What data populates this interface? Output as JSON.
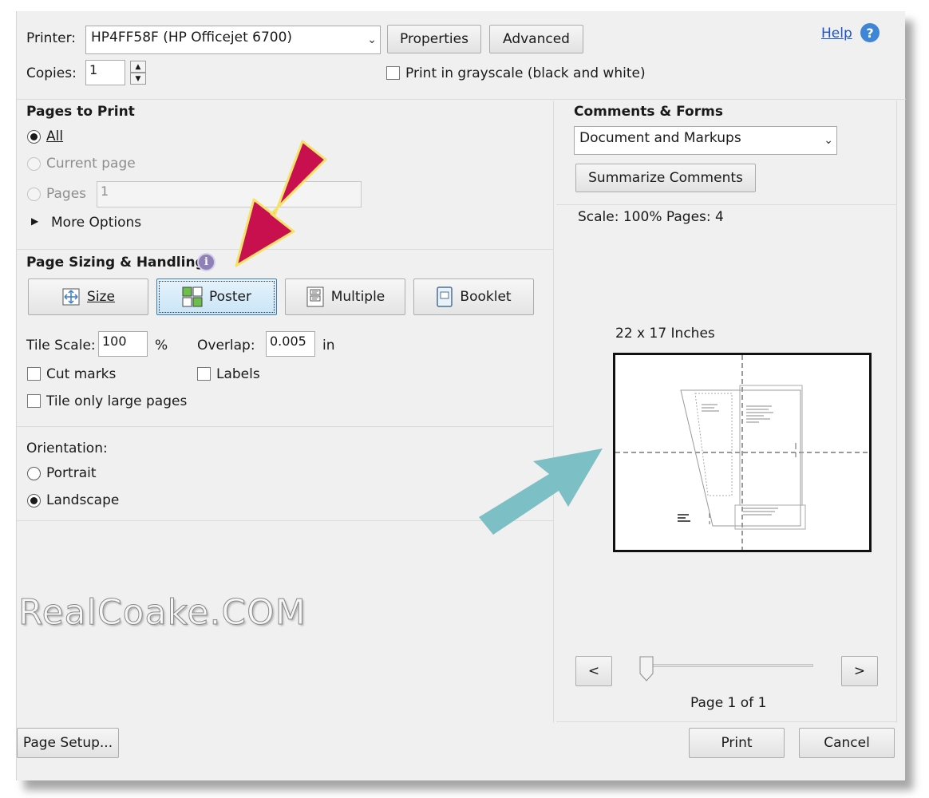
{
  "printer": {
    "label": "Printer:",
    "selected": "HP4FF58F (HP Officejet 6700)",
    "properties_button": "Properties",
    "advanced_button": "Advanced",
    "help_link": "Help"
  },
  "copies": {
    "label": "Copies:",
    "value": "1",
    "grayscale_label": "Print in grayscale (black and white)"
  },
  "pages_to_print": {
    "heading": "Pages to Print",
    "all_label": "All",
    "current_page_label": "Current page",
    "pages_label": "Pages",
    "pages_value": "1",
    "more_options_label": "More Options"
  },
  "page_sizing": {
    "heading": "Page Sizing & Handling",
    "buttons": {
      "size": "Size",
      "poster": "Poster",
      "multiple": "Multiple",
      "booklet": "Booklet"
    },
    "active_mode": "Poster",
    "tile_scale_label": "Tile Scale:",
    "tile_scale_value": "100",
    "tile_scale_unit": "%",
    "overlap_label": "Overlap:",
    "overlap_value": "0.005",
    "overlap_unit": "in",
    "cut_marks_label": "Cut marks",
    "labels_label": "Labels",
    "tile_large_label": "Tile only large pages"
  },
  "orientation": {
    "heading": "Orientation:",
    "portrait_label": "Portrait",
    "landscape_label": "Landscape",
    "selected": "Landscape"
  },
  "comments_forms": {
    "heading": "Comments & Forms",
    "selected": "Document and Markups",
    "summarize_button": "Summarize Comments"
  },
  "preview": {
    "scale_info": "Scale: 100% Pages: 4",
    "paper_size": "22 x 17 Inches",
    "prev_button": "<",
    "next_button": ">",
    "page_indicator": "Page 1 of 1"
  },
  "footer": {
    "page_setup_button": "Page Setup...",
    "print_button": "Print",
    "cancel_button": "Cancel"
  },
  "watermark": "RealCoake.COM",
  "colors": {
    "help_link": "#1a56c4",
    "annotation_arrow_red": "#c8104e",
    "annotation_arrow_outline": "#f4e26a",
    "annotation_arrow_teal": "#7cbfc4",
    "active_button": "#c9e5f7"
  }
}
